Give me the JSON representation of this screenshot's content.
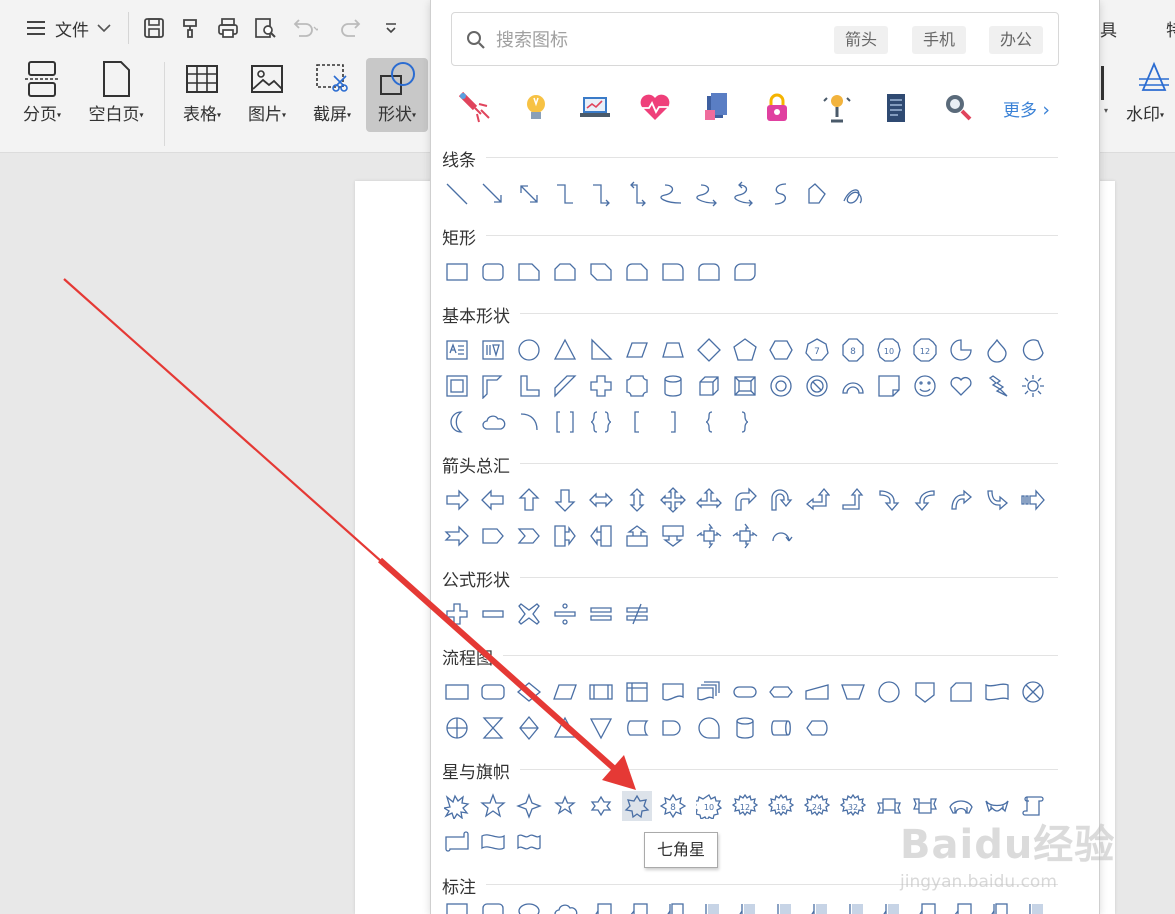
{
  "toolbar": {
    "file_label": "文件",
    "buttons": [
      {
        "label": "分页",
        "icon": "page-break-icon"
      },
      {
        "label": "空白页",
        "icon": "blank-page-icon"
      },
      {
        "label": "表格",
        "icon": "table-icon"
      },
      {
        "label": "图片",
        "icon": "picture-icon"
      },
      {
        "label": "截屏",
        "icon": "screenshot-icon"
      },
      {
        "label": "形状",
        "icon": "shape-icon",
        "active": true
      }
    ],
    "right_partial_label": "具",
    "right_edge_label": "特",
    "watermark_label": "水印"
  },
  "dropdown": {
    "search_placeholder": "搜索图标",
    "tags": [
      "箭头",
      "手机",
      "办公"
    ],
    "quick_icons": [
      "firework-icon",
      "lightbulb-icon",
      "laptop-chart-icon",
      "heartbeat-icon",
      "documents-icon",
      "lock-icon",
      "trophy-icon",
      "notebook-icon",
      "magnifier-gear-icon"
    ],
    "more_label": "更多",
    "sections": [
      {
        "title": "线条"
      },
      {
        "title": "矩形"
      },
      {
        "title": "基本形状"
      },
      {
        "title": "箭头总汇"
      },
      {
        "title": "公式形状"
      },
      {
        "title": "流程图"
      },
      {
        "title": "星与旗帜"
      },
      {
        "title": "标注"
      }
    ],
    "tooltip": "七角星"
  },
  "watermark": "Baidu经验",
  "watermark_url": "jingyan.baidu.com",
  "colors": {
    "shape_stroke": "#4a6fa5",
    "annotation_arrow": "#e53935",
    "link_blue": "#3b82d6"
  }
}
